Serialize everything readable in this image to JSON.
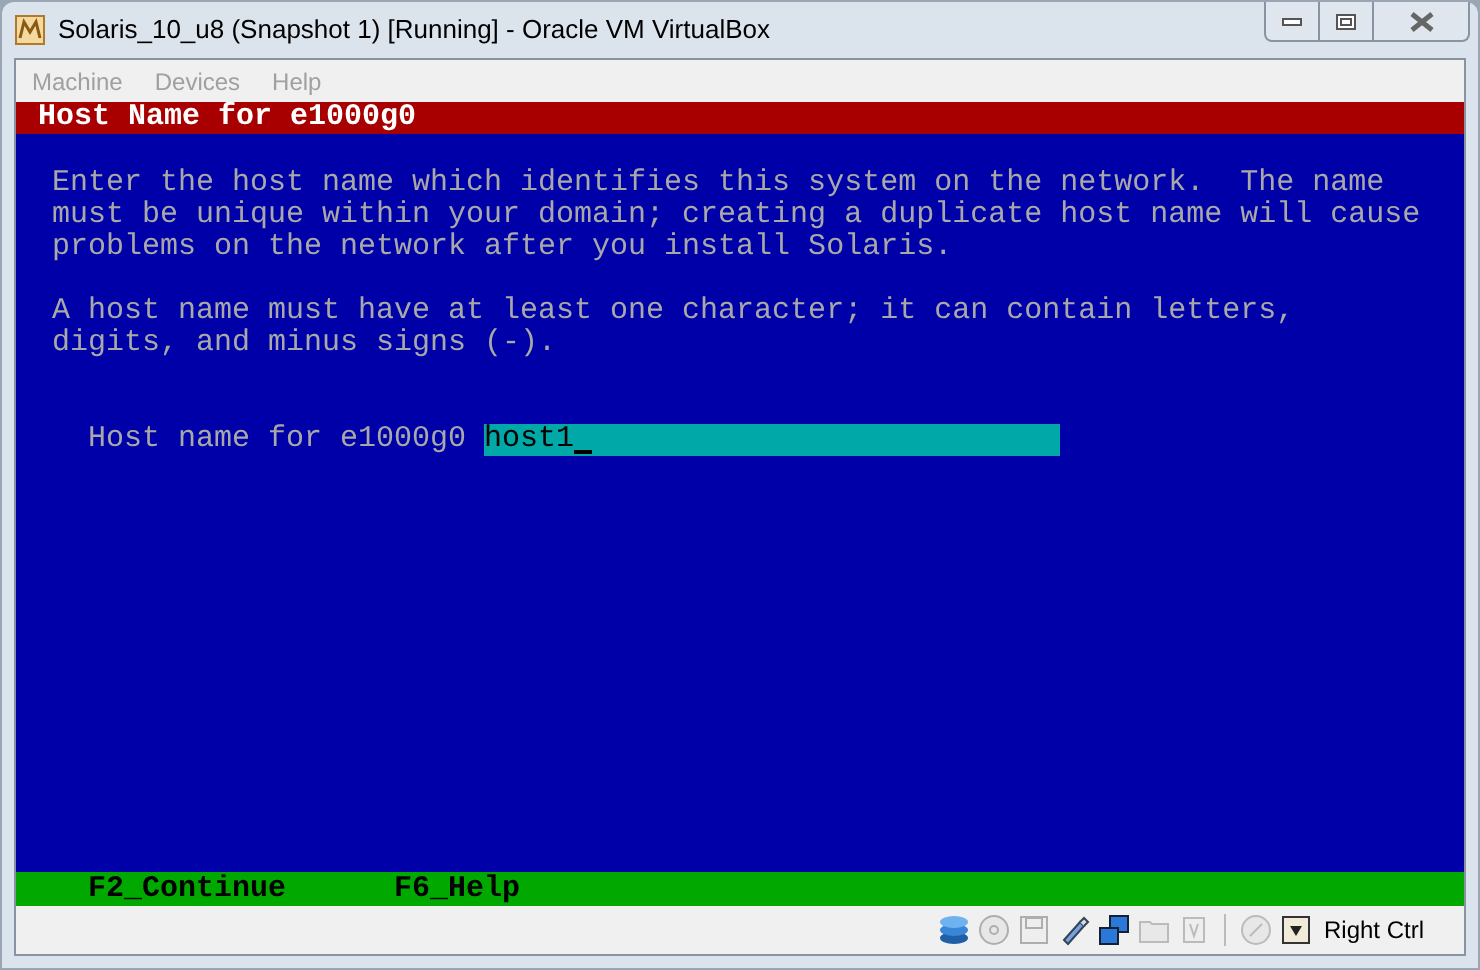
{
  "window": {
    "title": "Solaris_10_u8 (Snapshot 1) [Running] - Oracle VM VirtualBox"
  },
  "menu": [
    {
      "label": "Machine",
      "disabled": true
    },
    {
      "label": "Devices",
      "disabled": true
    },
    {
      "label": "Help",
      "disabled": true
    }
  ],
  "console": {
    "header": "Host Name for e1000g0",
    "paragraphs": [
      [
        "Enter the host name which identifies this system on the network.  The name",
        "must be unique within your domain; creating a duplicate host name will cause",
        "problems on the network after you install Solaris."
      ],
      [
        "A host name must have at least one character; it can contain letters,",
        "digits, and minus signs (-)."
      ]
    ],
    "field": {
      "label": "Host name for e1000g0",
      "value": "host1"
    },
    "footer": [
      {
        "label": "F2_Continue"
      },
      {
        "label": "F6_Help"
      }
    ]
  },
  "status_bar": {
    "icons": [
      {
        "kind": "disks",
        "disabled": false
      },
      {
        "kind": "cd",
        "disabled": true
      },
      {
        "kind": "floppy",
        "disabled": true
      },
      {
        "kind": "usb",
        "disabled": false
      },
      {
        "kind": "network",
        "disabled": false
      },
      {
        "kind": "folder",
        "disabled": true
      },
      {
        "kind": "chip",
        "disabled": true
      },
      {
        "kind": "mouse",
        "disabled": true
      },
      {
        "kind": "arrow",
        "disabled": false
      }
    ],
    "host_key": "Right Ctrl"
  }
}
